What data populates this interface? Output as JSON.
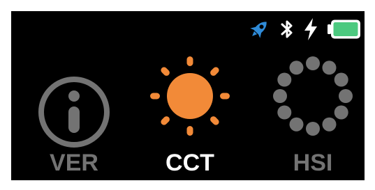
{
  "status_bar": {
    "icons": [
      "rocket-icon",
      "bluetooth-icon",
      "charging-bolt-icon",
      "battery-icon"
    ],
    "battery_level": 1.0,
    "colors": {
      "rocket": "#2f8bd8",
      "battery_fill": "#4cc97f",
      "icon_white": "#ffffff"
    }
  },
  "modes": [
    {
      "label": "VER",
      "icon": "info-icon",
      "active": false
    },
    {
      "label": "CCT",
      "icon": "sun-icon",
      "active": true
    },
    {
      "label": "HSI",
      "icon": "dots-ring-icon",
      "active": false
    }
  ],
  "colors": {
    "background": "#000000",
    "inactive": "#737373",
    "active_text": "#ffffff",
    "sun": "#f28a38"
  }
}
